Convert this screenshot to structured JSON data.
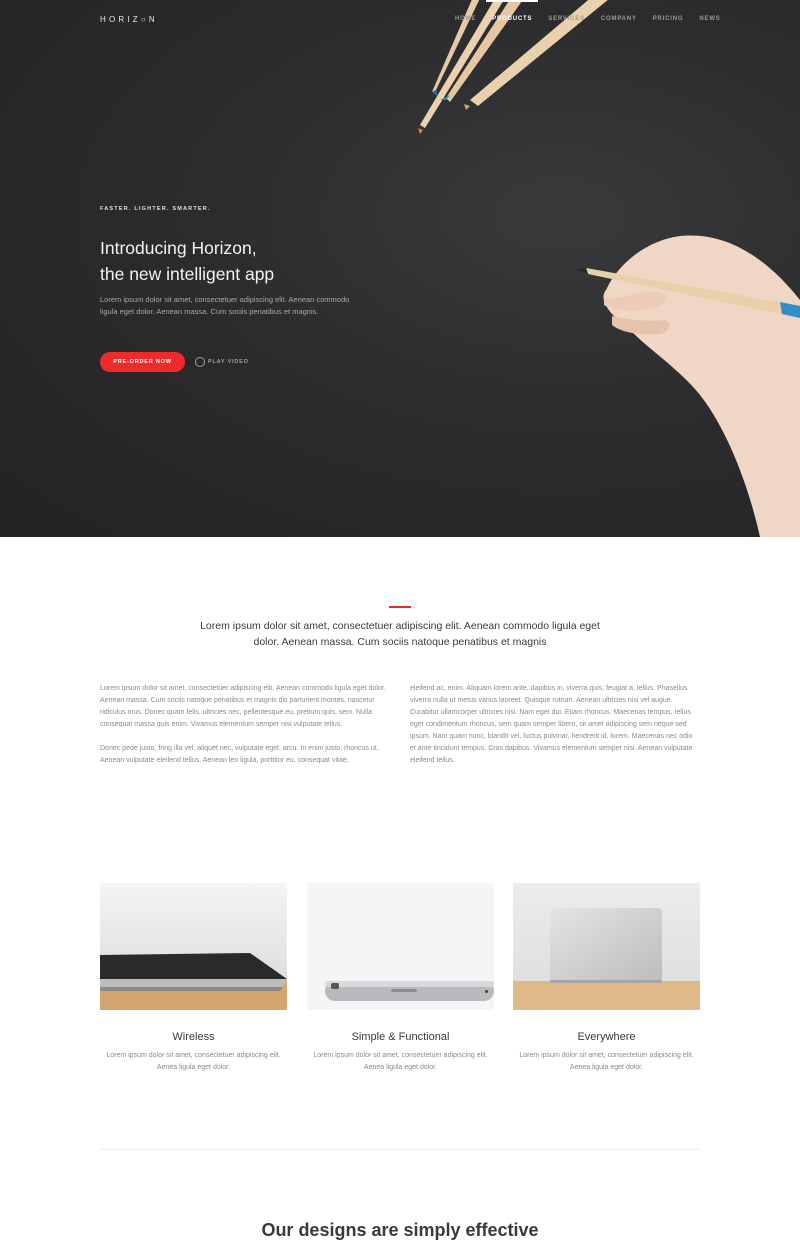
{
  "brand": {
    "logo": "HORIZ○N"
  },
  "nav": {
    "items": [
      "HOME",
      "PRODUCTS",
      "SERVICES",
      "COMPANY",
      "PRICING",
      "NEWS"
    ],
    "active_index": 1
  },
  "hero": {
    "eyebrow": "FASTER. LIGHTER. SMARTER.",
    "title_line1": "Introducing Horizon,",
    "title_line2": "the new intelligent app",
    "subtitle": "Lorem ipsum dolor sit amet, consectetuer adipiscing elit. Aenean commodo ligula eget dolor. Aenean massa. Cum sociis penatibus et magnis.",
    "cta_label": "PRE-ORDER NOW",
    "play_label": "PLAY VIDEO"
  },
  "intro": {
    "lead": "Lorem ipsum dolor sit amet, consectetuer adipiscing elit. Aenean commodo ligula eget dolor. Aenean massa. Cum sociis natoque penatibus et magnis",
    "left_p1": "Lorem ipsum dolor sit amet, consectetuer adipiscing elit. Aenean commodo ligula eget dolor. Aenean massa. Cum sociis natoque penatibus et magnis dis parturient montes, nascetur ridiculus mus. Donec quam felis, ultricies nec, pellentesque eu, pretium quis, sem. Nulla consequat massa quis enim. Vivamus elementum semper nisi vulputate tellus.",
    "left_p2": "Donec pede justo, fring illa vel, aliquet nec, vulputate eget, arcu. In enim justo, rhoncus ut. Aenean vulputate eleifend tellus. Aenean leo ligula, porttitor eu, consequat vitae,",
    "right_p1": "eleifend ac, enim. Aliquam lorem ante, dapibus in, viverra quis, feugiat a, tellus. Phasellus viverra nulla ut metus varius laoreet. Quisque rutrum. Aenean ultricies nisi vel augue. Curabitur ullamcorper ultricies nisi. Nam eget dui. Etiam rhoncus. Maecenas tempus, tellus eget condimentum rhoncus, sem quam semper libero, sit amet adipiscing sem neque sed ipsum. Nam quam nunc, blandit vel, luctus pulvinar, hendrerit id, lorem. Maecenas nec odio et ante tincidunt tempus. Cras dapibus. Vivamus elementum semper nisi. Aenean vulputate eleifend tellus."
  },
  "features": [
    {
      "title": "Wireless",
      "desc": "Lorem ipsum dolor sit amet, consectetuer adipiscing elit. Aenea ligula eget dolor."
    },
    {
      "title": "Simple & Functional",
      "desc": "Lorem ipsum dolor sit amet, consectetuer adipiscing elit. Aenea ligula eget dolor."
    },
    {
      "title": "Everywhere",
      "desc": "Lorem ipsum dolor sit amet, consectetuer adipiscing elit. Aenea ligula eget dolor."
    }
  ],
  "bottom": {
    "title": "Our designs are simply effective"
  },
  "colors": {
    "accent": "#ee2b2b",
    "hero_bg": "#2c2c2e",
    "text": "#3a3a3a",
    "muted": "#8a8a8a"
  }
}
